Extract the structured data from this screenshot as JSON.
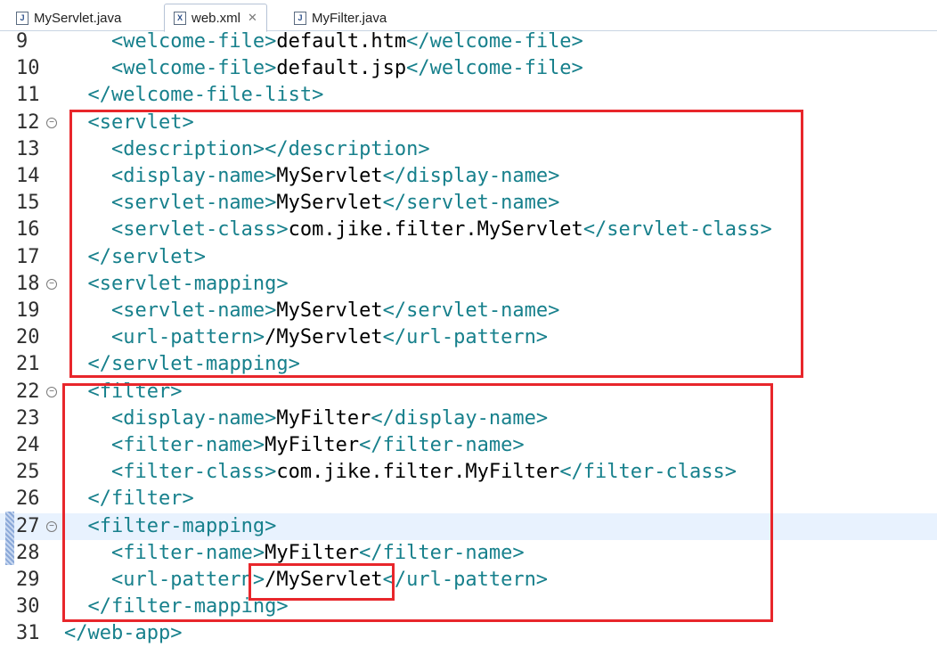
{
  "tabs": [
    {
      "label": "MyServlet.java",
      "icon": "java-file-icon",
      "active": false
    },
    {
      "label": "web.xml",
      "icon": "xml-file-icon",
      "active": true,
      "close": "✕"
    },
    {
      "label": "MyFilter.java",
      "icon": "java-file-icon",
      "active": false
    }
  ],
  "lines": [
    {
      "num": "9",
      "indent": "    ",
      "parts": [
        [
          "tag",
          "<welcome-file>"
        ],
        [
          "txt",
          "default.htm"
        ],
        [
          "tag",
          "</welcome-file>"
        ]
      ]
    },
    {
      "num": "10",
      "indent": "    ",
      "parts": [
        [
          "tag",
          "<welcome-file>"
        ],
        [
          "txt",
          "default.jsp"
        ],
        [
          "tag",
          "</welcome-file>"
        ]
      ]
    },
    {
      "num": "11",
      "indent": "  ",
      "parts": [
        [
          "tag",
          "</welcome-file-list>"
        ]
      ]
    },
    {
      "num": "12",
      "indent": "  ",
      "fold": true,
      "parts": [
        [
          "tag",
          "<servlet>"
        ]
      ]
    },
    {
      "num": "13",
      "indent": "    ",
      "parts": [
        [
          "tag",
          "<description></description>"
        ]
      ]
    },
    {
      "num": "14",
      "indent": "    ",
      "parts": [
        [
          "tag",
          "<display-name>"
        ],
        [
          "txt",
          "MyServlet"
        ],
        [
          "tag",
          "</display-name>"
        ]
      ]
    },
    {
      "num": "15",
      "indent": "    ",
      "parts": [
        [
          "tag",
          "<servlet-name>"
        ],
        [
          "txt",
          "MyServlet"
        ],
        [
          "tag",
          "</servlet-name>"
        ]
      ]
    },
    {
      "num": "16",
      "indent": "    ",
      "parts": [
        [
          "tag",
          "<servlet-class>"
        ],
        [
          "txt",
          "com.jike.filter.MyServlet"
        ],
        [
          "tag",
          "</servlet-class>"
        ]
      ]
    },
    {
      "num": "17",
      "indent": "  ",
      "parts": [
        [
          "tag",
          "</servlet>"
        ]
      ]
    },
    {
      "num": "18",
      "indent": "  ",
      "fold": true,
      "parts": [
        [
          "tag",
          "<servlet-mapping>"
        ]
      ]
    },
    {
      "num": "19",
      "indent": "    ",
      "parts": [
        [
          "tag",
          "<servlet-name>"
        ],
        [
          "txt",
          "MyServlet"
        ],
        [
          "tag",
          "</servlet-name>"
        ]
      ]
    },
    {
      "num": "20",
      "indent": "    ",
      "parts": [
        [
          "tag",
          "<url-pattern>"
        ],
        [
          "txt",
          "/MyServlet"
        ],
        [
          "tag",
          "</url-pattern>"
        ]
      ]
    },
    {
      "num": "21",
      "indent": "  ",
      "parts": [
        [
          "tag",
          "</servlet-mapping>"
        ]
      ]
    },
    {
      "num": "22",
      "indent": "  ",
      "fold": true,
      "parts": [
        [
          "tag",
          "<filter>"
        ]
      ]
    },
    {
      "num": "23",
      "indent": "    ",
      "parts": [
        [
          "tag",
          "<display-name>"
        ],
        [
          "txt",
          "MyFilter"
        ],
        [
          "tag",
          "</display-name>"
        ]
      ]
    },
    {
      "num": "24",
      "indent": "    ",
      "parts": [
        [
          "tag",
          "<filter-name>"
        ],
        [
          "txt",
          "MyFilter"
        ],
        [
          "tag",
          "</filter-name>"
        ]
      ]
    },
    {
      "num": "25",
      "indent": "    ",
      "parts": [
        [
          "tag",
          "<filter-class>"
        ],
        [
          "txt",
          "com.jike.filter.MyFilter"
        ],
        [
          "tag",
          "</filter-class>"
        ]
      ]
    },
    {
      "num": "26",
      "indent": "  ",
      "parts": [
        [
          "tag",
          "</filter>"
        ]
      ]
    },
    {
      "num": "27",
      "indent": "  ",
      "fold": true,
      "current": true,
      "parts": [
        [
          "tag",
          "<filter-mapping>"
        ]
      ]
    },
    {
      "num": "28",
      "indent": "    ",
      "parts": [
        [
          "tag",
          "<filter-name>"
        ],
        [
          "txt",
          "MyFilter"
        ],
        [
          "tag",
          "</filter-name>"
        ]
      ]
    },
    {
      "num": "29",
      "indent": "    ",
      "parts": [
        [
          "tag",
          "<url-pattern>"
        ],
        [
          "txt",
          "/MyServlet"
        ],
        [
          "tag",
          "</url-pattern>"
        ]
      ]
    },
    {
      "num": "30",
      "indent": "  ",
      "parts": [
        [
          "tag",
          "</filter-mapping>"
        ]
      ]
    },
    {
      "num": "31",
      "indent": "",
      "parts": [
        [
          "tag",
          "</web-app>"
        ]
      ]
    }
  ],
  "colors": {
    "tag": "#17808c",
    "text": "#000000",
    "highlight": "#e8262b",
    "current_line": "#e8f2fe"
  }
}
